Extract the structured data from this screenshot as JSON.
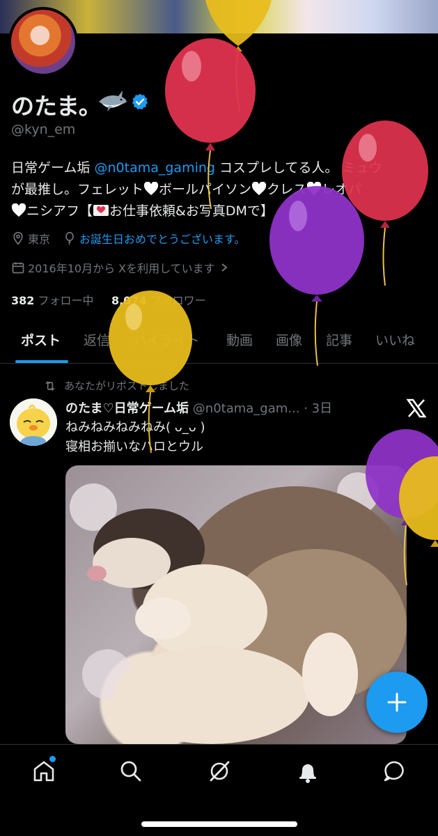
{
  "profile": {
    "display_name": "のたま。",
    "handle": "@kyn_em",
    "bio": {
      "line1_a": "日常ゲーム垢 ",
      "line1_link": "@n0tama_gaming",
      "line1_b": " コスプレしてる人。 ミュウ",
      "line2_a": "が最推し。フェレット",
      "line2_b": "ボールパイソン",
      "line2_c": "クレス",
      "line2_d": "レオパ",
      "line3_a": "ニシアフ【",
      "line3_b": "お仕事依頼&お写真DMで】"
    },
    "location": "東京",
    "birthday_link": "お誕生日おめでとうございます。",
    "joined": "2016年10月から Xを利用しています",
    "following_count": "382",
    "following_label": "フォロー中",
    "followers_count": "8,074",
    "followers_label": "フォロワー"
  },
  "tabs": [
    "ポスト",
    "返信",
    "ハイライト",
    "動画",
    "画像",
    "記事",
    "いいね"
  ],
  "active_tab": "ポスト",
  "post": {
    "repost_label": "あなたがリポストしました",
    "author": "のたま♡日常ゲーム垢",
    "handle": "@n0tama_gam...",
    "time": "· 3日",
    "text_line1": "ねみねみねみねみ( ᴗ_ᴗ )",
    "text_line2": "寝相お揃いなハロとウル"
  },
  "icons": {
    "verified": "verified-badge-icon",
    "shark": "shark-emoji-icon",
    "location": "location-pin-icon",
    "birthday": "balloon-icon",
    "calendar": "calendar-icon",
    "repost": "repost-icon",
    "x_logo": "x-logo-icon",
    "compose": "plus-icon",
    "nav": [
      "home-icon",
      "search-icon",
      "grok-icon",
      "notifications-icon",
      "messages-icon"
    ]
  },
  "colors": {
    "accent": "#1d9bf0",
    "background": "#000000",
    "text_primary": "#e7e9ea",
    "text_secondary": "#71767b",
    "balloon_red": "#e0334f",
    "balloon_purple": "#8f33c8",
    "balloon_yellow": "#e8bc1c"
  }
}
